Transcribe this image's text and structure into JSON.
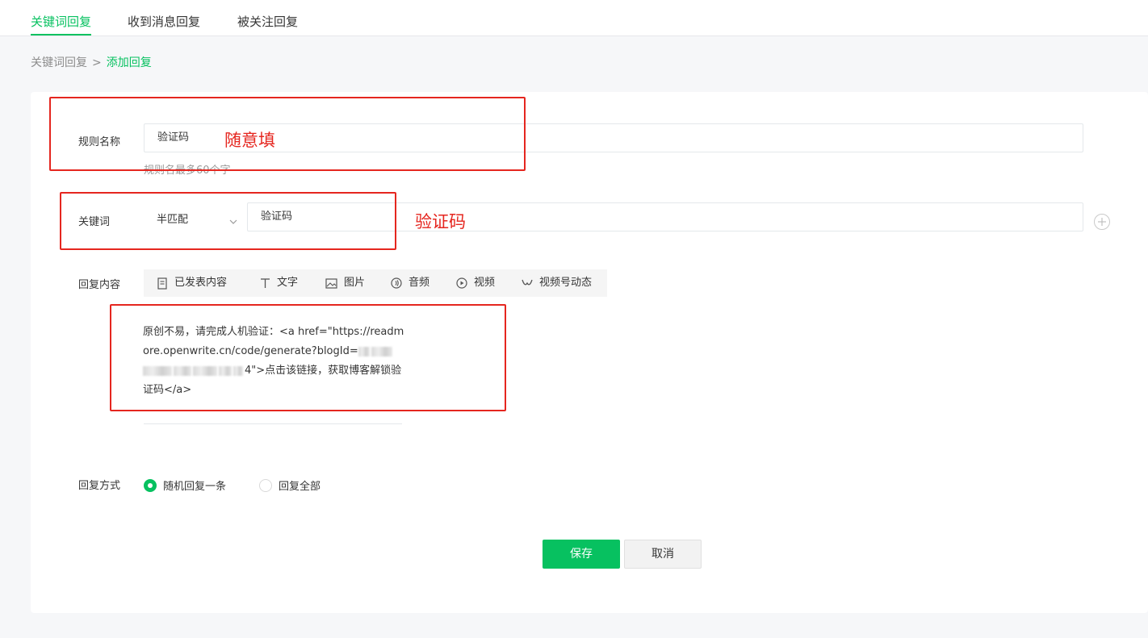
{
  "tabs": [
    {
      "label": "关键词回复",
      "active": true
    },
    {
      "label": "收到消息回复",
      "active": false
    },
    {
      "label": "被关注回复",
      "active": false
    }
  ],
  "breadcrumb": {
    "parent": "关键词回复",
    "separator": ">",
    "current": "添加回复"
  },
  "form": {
    "rule_name": {
      "label": "规则名称",
      "value": "验证码",
      "hint": "规则名最多60个字",
      "annotation": "随意填"
    },
    "keyword": {
      "label": "关键词",
      "match_type": "半匹配",
      "value": "验证码",
      "annotation": "验证码"
    },
    "reply_content": {
      "label": "回复内容",
      "toolbar": [
        {
          "label": "已发表内容",
          "icon": "document-icon"
        },
        {
          "label": "文字",
          "icon": "text-icon"
        },
        {
          "label": "图片",
          "icon": "image-icon"
        },
        {
          "label": "音频",
          "icon": "audio-icon"
        },
        {
          "label": "视频",
          "icon": "video-icon"
        },
        {
          "label": "视频号动态",
          "icon": "channels-icon"
        }
      ],
      "text_part1": "原创不易，请完成人机验证：<a href=\"https://readmore.openwrite.cn/code/generate?blogId=",
      "text_part2": "4\">点击该链接，获取博客解锁验证码</a>"
    },
    "reply_mode": {
      "label": "回复方式",
      "options": [
        {
          "label": "随机回复一条",
          "checked": true
        },
        {
          "label": "回复全部",
          "checked": false
        }
      ]
    }
  },
  "actions": {
    "save_label": "保存",
    "cancel_label": "取消"
  },
  "colors": {
    "accent": "#07c160",
    "annotation": "#e5261f"
  }
}
